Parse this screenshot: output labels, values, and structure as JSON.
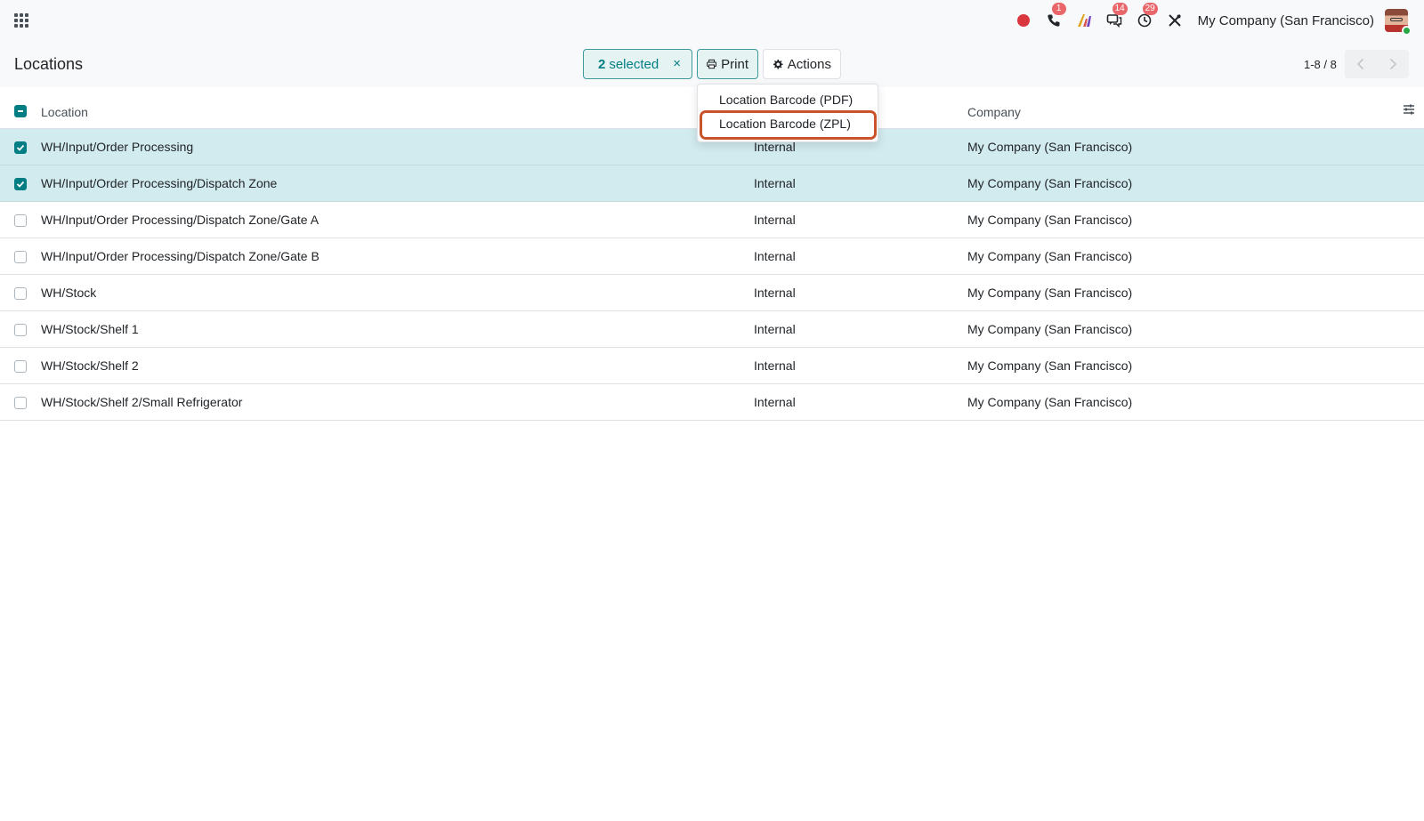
{
  "navbar": {
    "apps_icon": "grid-icon",
    "systray": [
      {
        "name": "record-icon",
        "badge": ""
      },
      {
        "name": "phone-icon",
        "badge": "1"
      },
      {
        "name": "ai-icon",
        "badge": ""
      },
      {
        "name": "discuss-icon",
        "badge": "14"
      },
      {
        "name": "activity-clock-icon",
        "badge": "29"
      },
      {
        "name": "debug-tools-icon",
        "badge": ""
      }
    ],
    "company": "My Company (San Francisco)"
  },
  "control_panel": {
    "title": "Locations",
    "selected_count": "2",
    "selected_label": "selected",
    "print_label": "Print",
    "actions_label": "Actions",
    "pager": "1-8 / 8"
  },
  "table": {
    "headers": {
      "location": "Location",
      "company": "Company"
    },
    "rows": [
      {
        "location": "WH/Input/Order Processing",
        "type": "Internal",
        "company": "My Company (San Francisco)",
        "selected": true
      },
      {
        "location": "WH/Input/Order Processing/Dispatch Zone",
        "type": "Internal",
        "company": "My Company (San Francisco)",
        "selected": true
      },
      {
        "location": "WH/Input/Order Processing/Dispatch Zone/Gate A",
        "type": "Internal",
        "company": "My Company (San Francisco)",
        "selected": false
      },
      {
        "location": "WH/Input/Order Processing/Dispatch Zone/Gate B",
        "type": "Internal",
        "company": "My Company (San Francisco)",
        "selected": false
      },
      {
        "location": "WH/Stock",
        "type": "Internal",
        "company": "My Company (San Francisco)",
        "selected": false
      },
      {
        "location": "WH/Stock/Shelf 1",
        "type": "Internal",
        "company": "My Company (San Francisco)",
        "selected": false
      },
      {
        "location": "WH/Stock/Shelf 2",
        "type": "Internal",
        "company": "My Company (San Francisco)",
        "selected": false
      },
      {
        "location": "WH/Stock/Shelf 2/Small Refrigerator",
        "type": "Internal",
        "company": "My Company (San Francisco)",
        "selected": false
      }
    ]
  },
  "print_menu": {
    "items": [
      "Location Barcode (PDF)",
      "Location Barcode (ZPL)"
    ],
    "highlighted_index": 1
  },
  "colors": {
    "accent": "#017e84",
    "selected_row": "#d2ebef",
    "highlight_border": "#c9542b",
    "badge": "#e9676a"
  }
}
